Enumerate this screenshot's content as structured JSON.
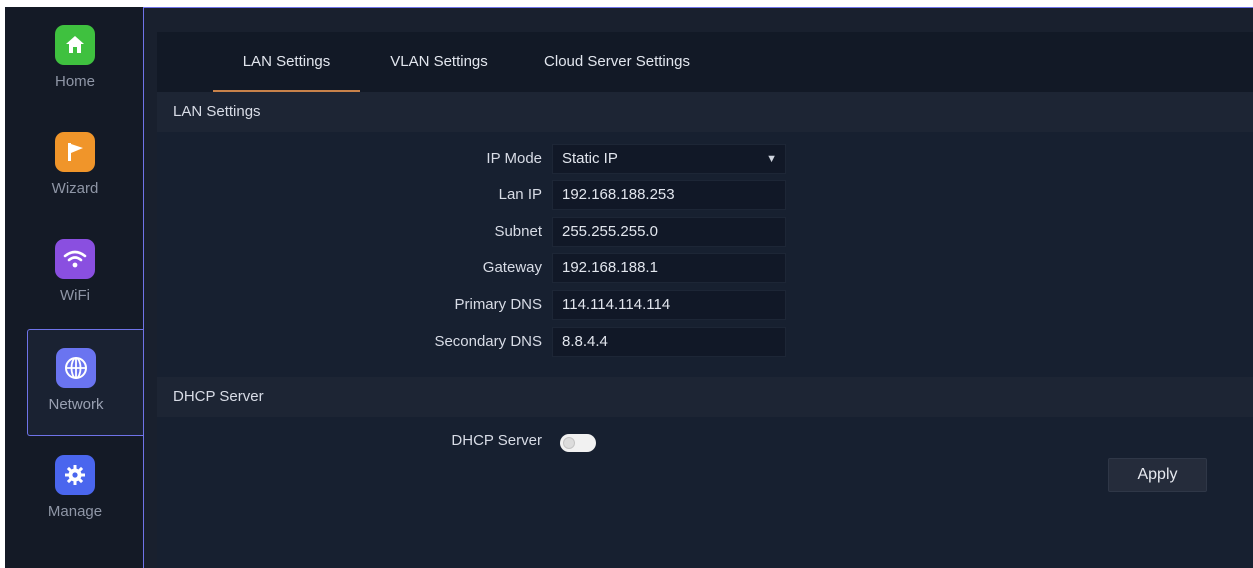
{
  "sidebar": {
    "items": [
      {
        "label": "Home",
        "icon": "home-icon",
        "color": "#3fc13f"
      },
      {
        "label": "Wizard",
        "icon": "flag-icon",
        "color": "#f0952a"
      },
      {
        "label": "WiFi",
        "icon": "wifi-icon",
        "color": "#8a4fe0"
      },
      {
        "label": "Network",
        "icon": "globe-icon",
        "color": "#6a74f0",
        "active": true
      },
      {
        "label": "Manage",
        "icon": "gear-icon",
        "color": "#4a66ee"
      }
    ]
  },
  "tabs": [
    {
      "label": "LAN Settings",
      "active": true
    },
    {
      "label": "VLAN Settings",
      "active": false
    },
    {
      "label": "Cloud Server Settings",
      "active": false
    }
  ],
  "lan": {
    "section_title": "LAN Settings",
    "fields": {
      "ip_mode": {
        "label": "IP Mode",
        "value": "Static IP"
      },
      "lan_ip": {
        "label": "Lan IP",
        "value": "192.168.188.253"
      },
      "subnet": {
        "label": "Subnet",
        "value": "255.255.255.0"
      },
      "gateway": {
        "label": "Gateway",
        "value": "192.168.188.1"
      },
      "primary_dns": {
        "label": "Primary DNS",
        "value": "114.114.114.114"
      },
      "secondary_dns": {
        "label": "Secondary DNS",
        "value": "8.8.4.4"
      }
    }
  },
  "dhcp": {
    "section_title": "DHCP Server",
    "label": "DHCP Server",
    "enabled": false
  },
  "apply_label": "Apply",
  "colors": {
    "accent_border": "#6f73e8",
    "tab_underline": "#c8824a"
  }
}
